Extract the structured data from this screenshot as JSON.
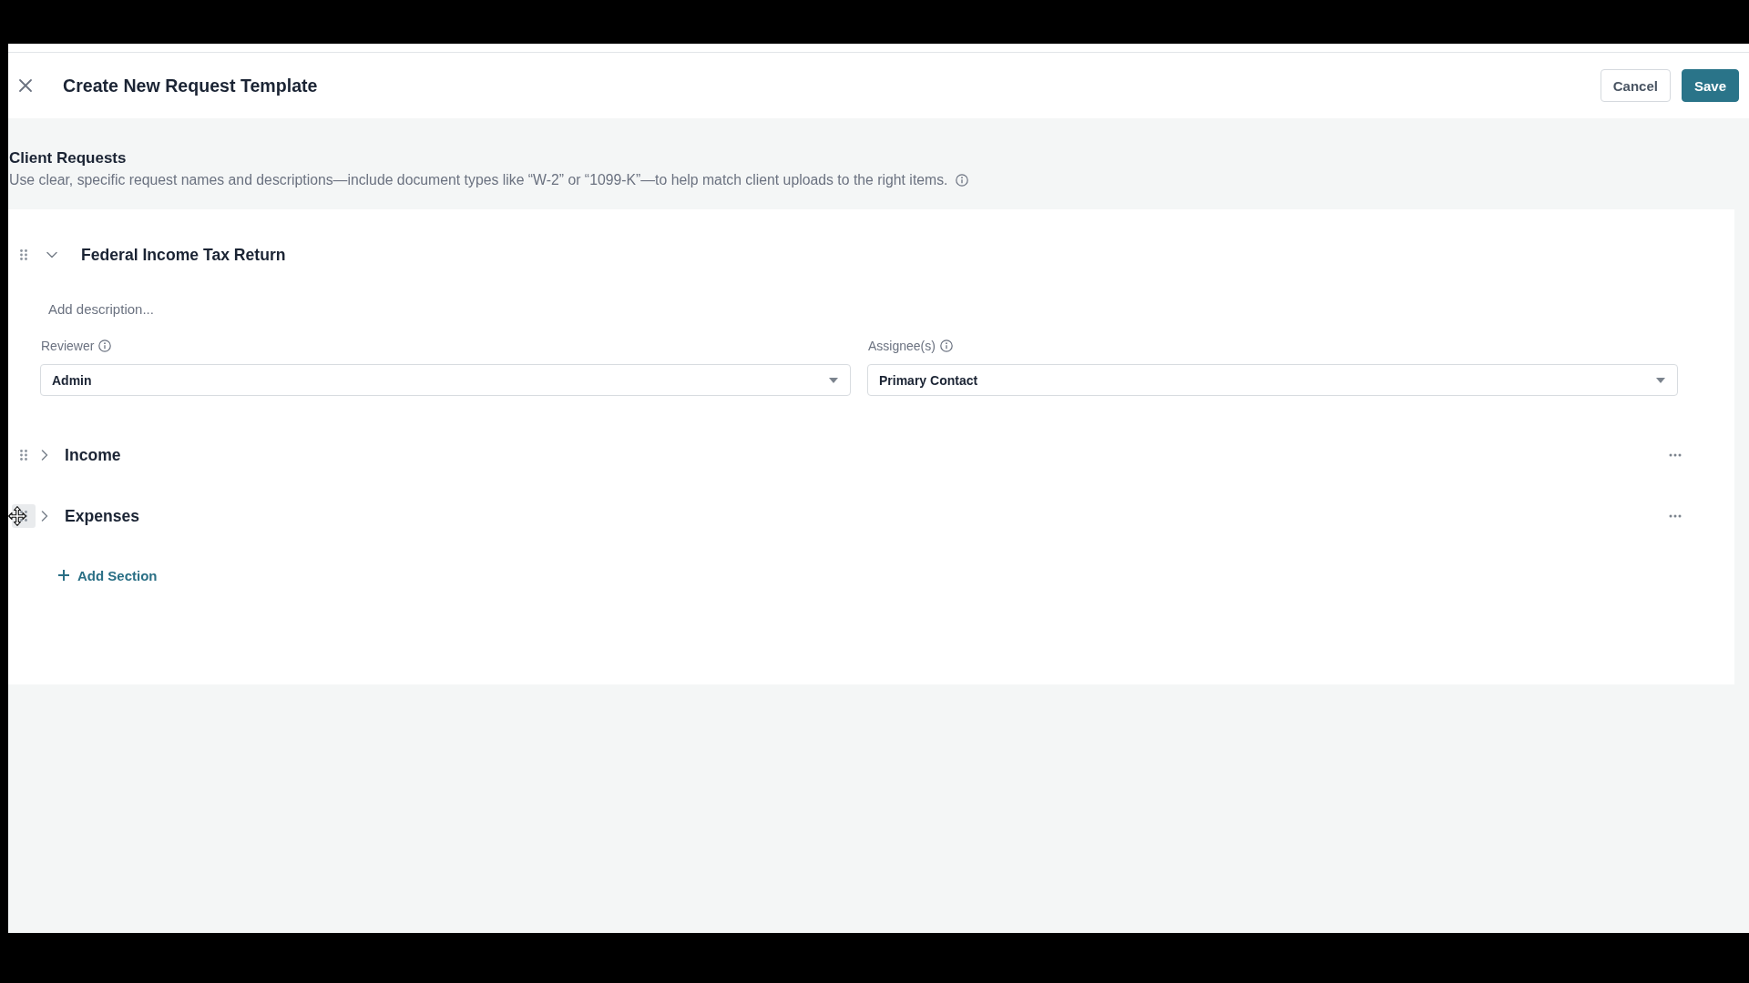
{
  "header": {
    "title": "Create New Request Template",
    "buttons": [
      {
        "label": "Cancel",
        "kind": "secondary"
      },
      {
        "label": "Save",
        "kind": "primary"
      }
    ]
  },
  "client_requests": {
    "title": "Client Requests",
    "description": "Use clear, specific request names and descriptions—include document types like “W-2” or “1099-K”—to help match client uploads to the right items."
  },
  "sections": [
    {
      "title": "Federal Income Tax Return",
      "expanded": true,
      "hovered": false,
      "description": {
        "placeholder": "Add description..."
      },
      "fields": [
        {
          "label": "Reviewer",
          "value": "Admin"
        },
        {
          "label": "Assignee(s)",
          "value": "Primary Contact"
        }
      ]
    },
    {
      "title": "Income",
      "expanded": false,
      "hovered": false
    },
    {
      "title": "Expenses",
      "expanded": false,
      "hovered": true
    }
  ],
  "add_section": {
    "label": "Add Section"
  }
}
